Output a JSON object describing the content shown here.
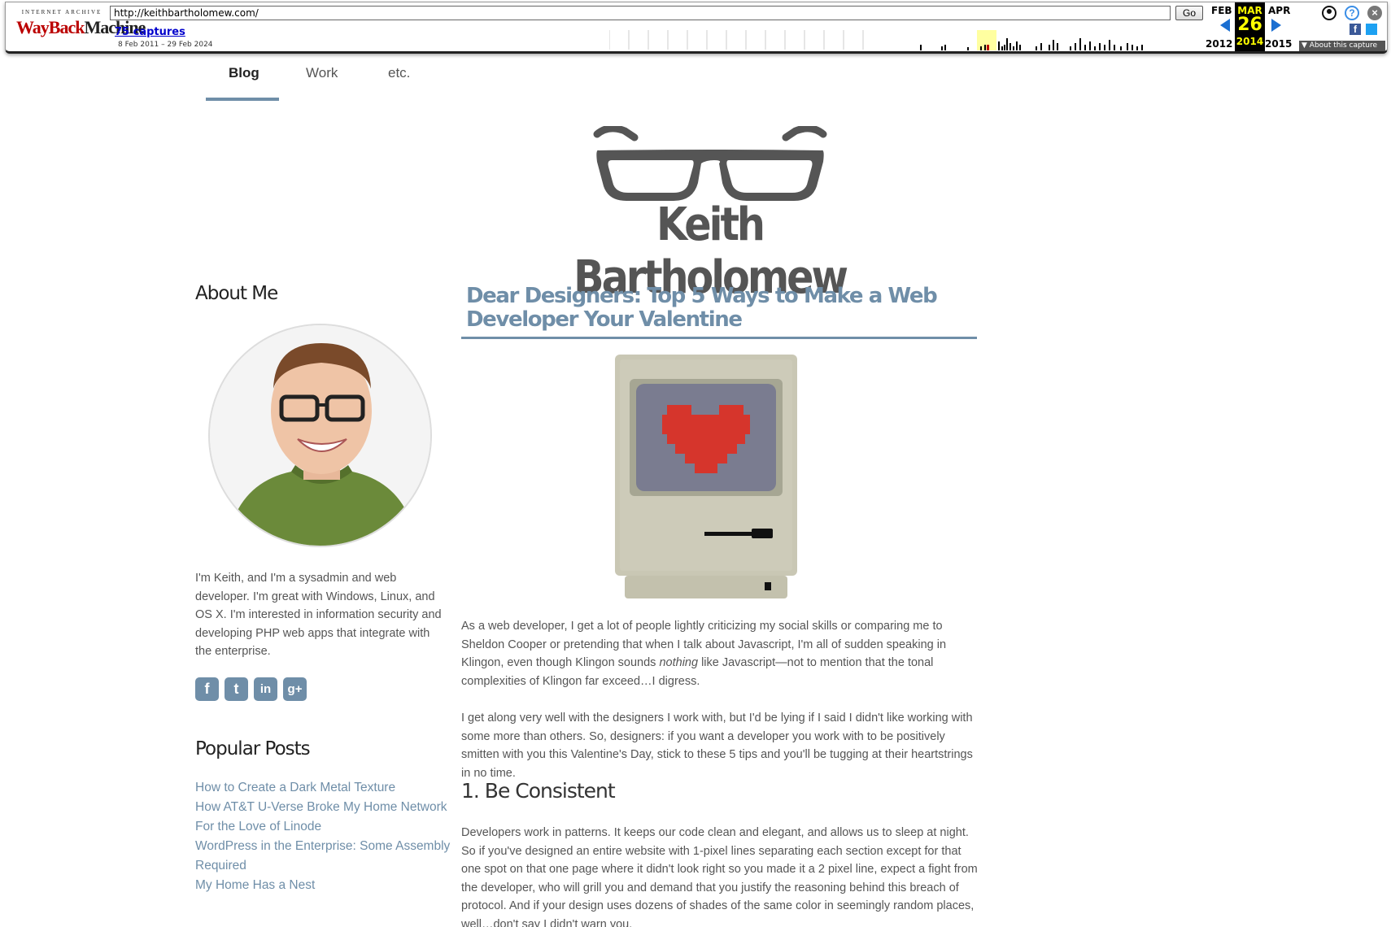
{
  "wayback": {
    "logo_top": "INTERNET ARCHIVE",
    "logo_way": "WayBack",
    "logo_machine": "Machine",
    "url": "http://keithbartholomew.com/",
    "go_label": "Go",
    "captures": "75 captures",
    "range": "8 Feb 2011 – 29 Feb 2024",
    "prev_month": "FEB",
    "cur_month": "MAR",
    "next_month": "APR",
    "prev_year": "2012",
    "cur_day": "26",
    "cur_year": "2014",
    "next_year": "2015",
    "about_label": "About this capture"
  },
  "nav": {
    "items": [
      "Blog",
      "Work",
      "etc."
    ],
    "active": "Blog"
  },
  "site": {
    "title": "Keith Bartholomew"
  },
  "sidebar": {
    "about_heading": "About Me",
    "about_text": "I'm Keith, and I'm a sysadmin and web developer. I'm great with Windows, Linux, and OS X. I'm interested in information security and developing PHP web apps that integrate with the enterprise.",
    "social": [
      {
        "icon": "facebook-icon",
        "glyph": "f"
      },
      {
        "icon": "twitter-icon",
        "glyph": "t"
      },
      {
        "icon": "linkedin-icon",
        "glyph": "in"
      },
      {
        "icon": "googleplus-icon",
        "glyph": "g+"
      }
    ],
    "popular_heading": "Popular Posts",
    "popular": [
      "How to Create a Dark Metal Texture",
      "How AT&T U-Verse Broke My Home Network",
      "For the Love of Linode",
      "WordPress in the Enterprise: Some Assembly Required",
      "My Home Has a Nest"
    ]
  },
  "post": {
    "title": "Dear Designers: Top 5 Ways to Make a Web Developer Your Valentine",
    "p1_before": "As a web developer, I get a lot of people lightly criticizing my social skills or comparing me to Sheldon Cooper or pretending that when I talk about Javascript, I'm all of sudden speaking in Klingon, even though Klingon sounds ",
    "p1_em": "nothing",
    "p1_after": " like Javascript—not to mention that the tonal complexities of Klingon far exceed…I digress.",
    "p2": "I get along very well with the designers I work with, but I'd be lying if I said I didn't like working with some more than others. So, designers: if you want a developer you work with to be positively smitten with you this Valentine's Day, stick to these 5 tips and you'll be tugging at their heartstrings in no time.",
    "h1": "1. Be Consistent",
    "p3": "Developers work in patterns. It keeps our code clean and elegant, and allows us to sleep at night. So if you've designed an entire website with 1-pixel lines separating each section except for that one spot on that one page where it didn't look right so you made it a 2 pixel line, expect a fight from the developer, who will grill you and demand that you justify the reasoning behind this breach of protocol. And if your design uses dozens of shades of the same color in seemingly random places, well…don't say I didn't warn you."
  },
  "colors": {
    "accent": "#6f8ea8",
    "text": "#555555",
    "heading": "#222222"
  }
}
